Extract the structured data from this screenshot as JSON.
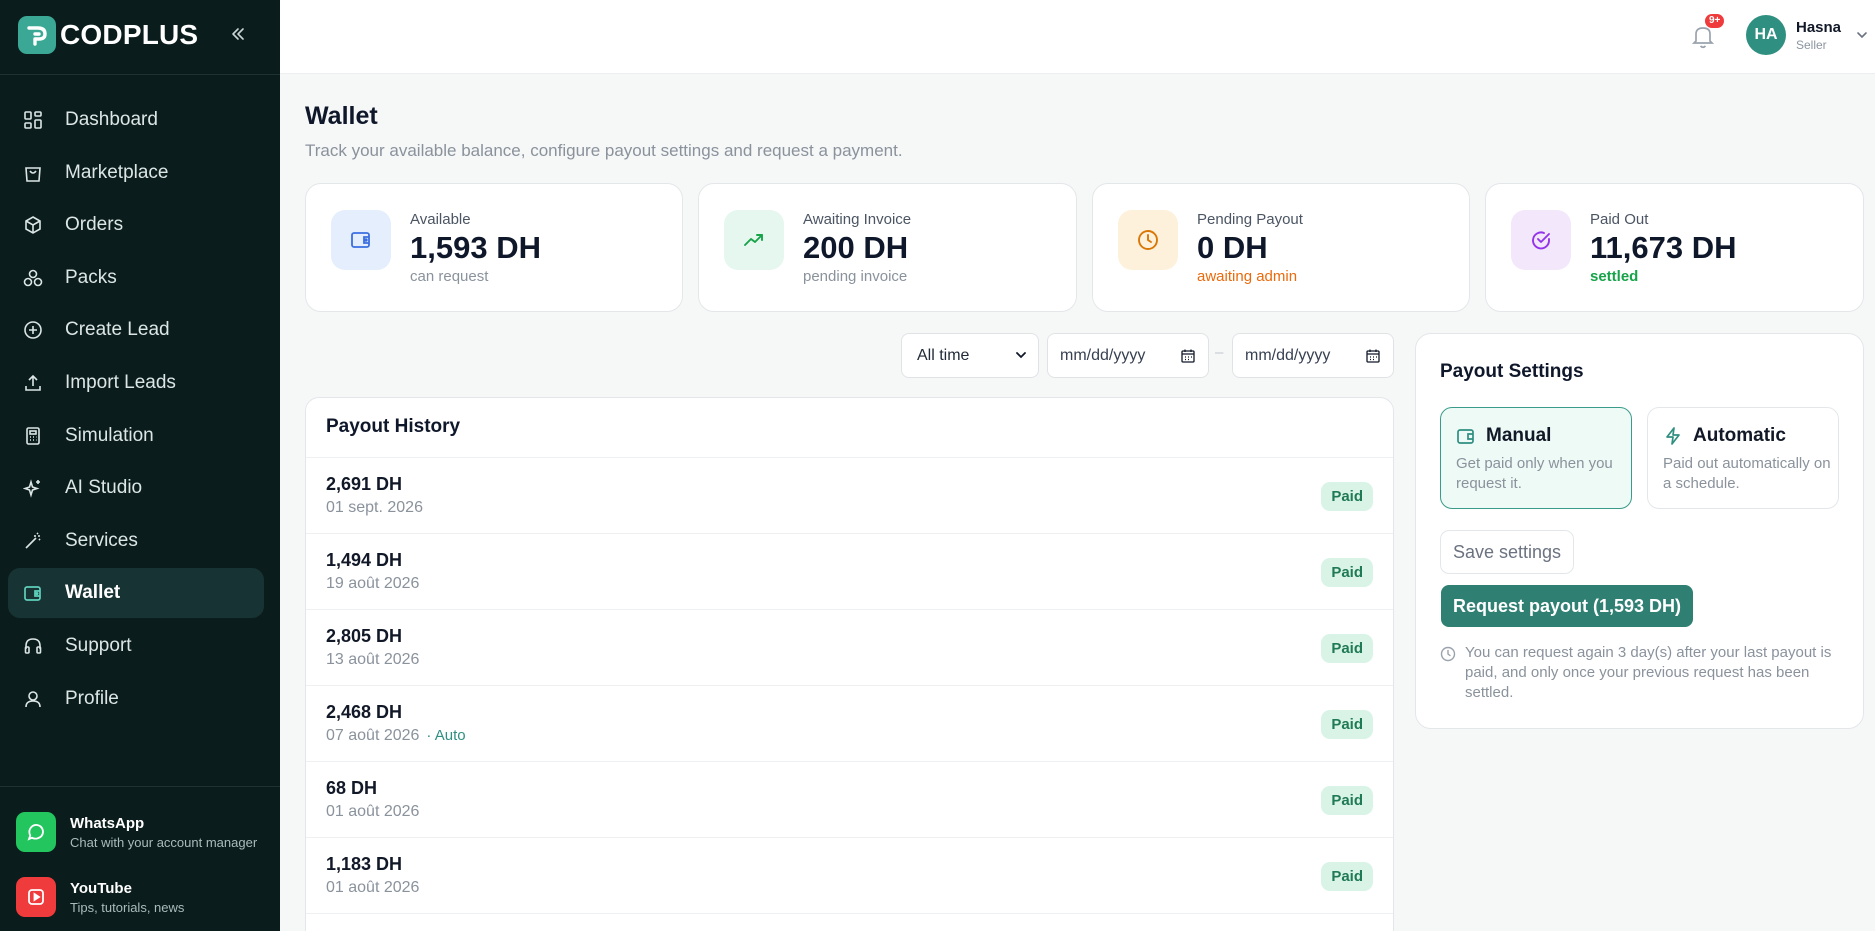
{
  "brand": {
    "name": "CODPLUS"
  },
  "sidebar": {
    "items": [
      {
        "label": "Dashboard",
        "icon": "dashboard-icon"
      },
      {
        "label": "Marketplace",
        "icon": "shopping-bag-icon"
      },
      {
        "label": "Orders",
        "icon": "box-icon"
      },
      {
        "label": "Packs",
        "icon": "packs-icon"
      },
      {
        "label": "Create Lead",
        "icon": "plus-circle-icon"
      },
      {
        "label": "Import Leads",
        "icon": "upload-icon"
      },
      {
        "label": "Simulation",
        "icon": "calculator-icon"
      },
      {
        "label": "AI Studio",
        "icon": "sparkles-icon"
      },
      {
        "label": "Services",
        "icon": "magic-wand-icon"
      },
      {
        "label": "Wallet",
        "icon": "wallet-icon",
        "active": true
      },
      {
        "label": "Support",
        "icon": "headphones-icon"
      },
      {
        "label": "Profile",
        "icon": "user-icon"
      }
    ],
    "promos": [
      {
        "title": "WhatsApp",
        "subtitle": "Chat with your account manager",
        "color": "#22c55e"
      },
      {
        "title": "YouTube",
        "subtitle": "Tips, tutorials, news",
        "color": "#ef3b3b"
      }
    ]
  },
  "topbar": {
    "notification_badge": "9+",
    "user": {
      "initials": "HA",
      "name": "Hasna",
      "role": "Seller"
    }
  },
  "page": {
    "title": "Wallet",
    "subtitle": "Track your available balance, configure payout settings and request a payment."
  },
  "cards": [
    {
      "label": "Available",
      "value": "1,593 DH",
      "sub": "can request",
      "sub_color": "#8a929c",
      "icon": "wallet-icon"
    },
    {
      "label": "Awaiting Invoice",
      "value": "200 DH",
      "sub": "pending invoice",
      "sub_color": "#8a929c",
      "icon": "trending-up-icon"
    },
    {
      "label": "Pending Payout",
      "value": "0 DH",
      "sub": "awaiting admin",
      "sub_color": "#ea6a0c",
      "icon": "clock-icon"
    },
    {
      "label": "Paid Out",
      "value": "11,673 DH",
      "sub": "settled",
      "sub_color": "#16a34a",
      "icon": "check-circle-icon"
    }
  ],
  "filters": {
    "range_selected": "All time",
    "date_from_placeholder": "mm/dd/yyyy",
    "date_to_placeholder": "mm/dd/yyyy",
    "separator": "–"
  },
  "history": {
    "title": "Payout History",
    "rows": [
      {
        "amount": "2,691 DH",
        "date": "01 sept. 2026",
        "tag": "",
        "status": "Paid"
      },
      {
        "amount": "1,494 DH",
        "date": "19 août 2026",
        "tag": "",
        "status": "Paid"
      },
      {
        "amount": "2,805 DH",
        "date": "13 août 2026",
        "tag": "",
        "status": "Paid"
      },
      {
        "amount": "2,468 DH",
        "date": "07 août 2026",
        "tag": "· Auto",
        "status": "Paid"
      },
      {
        "amount": "68 DH",
        "date": "01 août 2026",
        "tag": "",
        "status": "Paid"
      },
      {
        "amount": "1,183 DH",
        "date": "01 août 2026",
        "tag": "",
        "status": "Paid"
      },
      {
        "amount": "",
        "date": "",
        "tag": "",
        "status": ""
      }
    ]
  },
  "settings": {
    "title": "Payout Settings",
    "options": [
      {
        "title": "Manual",
        "desc": "Get paid only when you request it.",
        "selected": true
      },
      {
        "title": "Automatic",
        "desc": "Paid out automatically on a schedule.",
        "selected": false
      }
    ],
    "save_label": "Save settings",
    "request_label": "Request payout (1,593 DH)",
    "note": "You can request again 3 day(s) after your last payout is paid, and only once your previous request has been settled."
  }
}
